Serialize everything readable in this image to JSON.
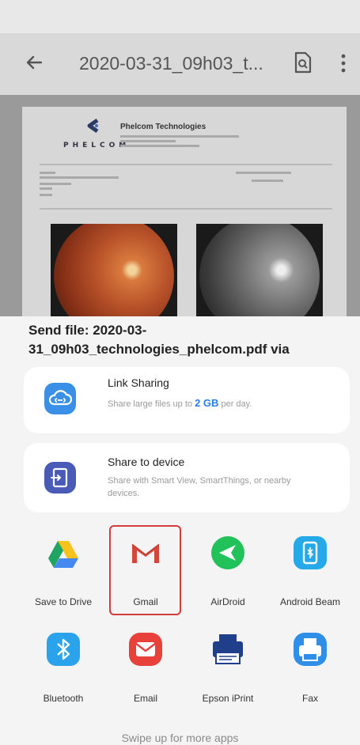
{
  "toolbar": {
    "title": "2020-03-31_09h03_t...",
    "icons": {
      "back": "back-arrow-icon",
      "document": "document-search-icon",
      "more": "more-vert-icon"
    }
  },
  "document": {
    "company": "Phelcom Technologies",
    "brand": "PHELCOM"
  },
  "share_sheet": {
    "title": "Send file: 2020-03-31_09h03_technologies_phelcom.pdf via",
    "options": [
      {
        "title": "Link Sharing",
        "desc_before": "Share large files up to ",
        "desc_highlight": "2 GB",
        "desc_after": " per day.",
        "icon": "cloud-link-icon"
      },
      {
        "title": "Share to device",
        "desc": "Share with Smart View, SmartThings, or nearby devices.",
        "icon": "share-device-icon"
      }
    ],
    "apps": [
      {
        "label": "Save to Drive",
        "icon": "google-drive-icon"
      },
      {
        "label": "Gmail",
        "icon": "gmail-icon"
      },
      {
        "label": "AirDroid",
        "icon": "airdroid-icon"
      },
      {
        "label": "Android Beam",
        "icon": "android-beam-icon"
      },
      {
        "label": "Bluetooth",
        "icon": "bluetooth-icon"
      },
      {
        "label": "Email",
        "icon": "email-icon"
      },
      {
        "label": "Epson iPrint",
        "icon": "epson-printer-icon"
      },
      {
        "label": "Fax",
        "icon": "fax-icon"
      }
    ],
    "hint": "Swipe up for more apps"
  },
  "colors": {
    "accent": "#2b7de9",
    "highlight": "#d43b3b"
  }
}
